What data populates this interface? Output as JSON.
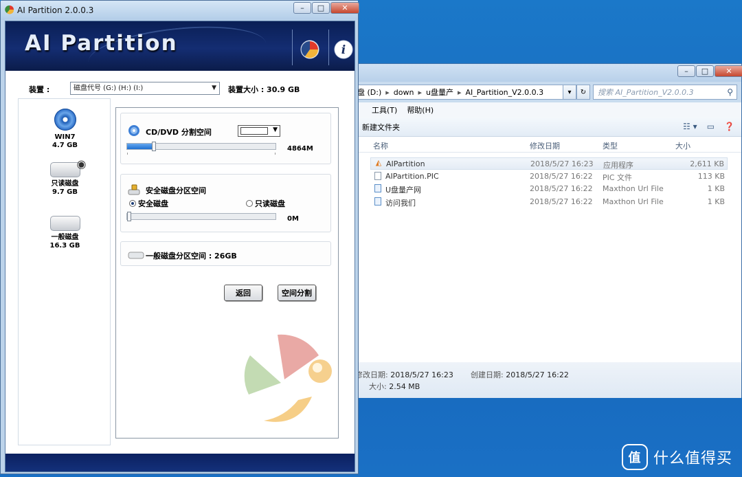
{
  "explorer": {
    "address_crumbs": [
      "盘 (D:)",
      "down",
      "u盘量产",
      "AI_Partition_V2.0.0.3"
    ],
    "search_placeholder": "搜索 AI_Partition_V2.0.0.3",
    "menu": [
      "工具(T)",
      "帮助(H)"
    ],
    "toolbar_new_folder": "新建文件夹",
    "columns": {
      "name": "名称",
      "modified": "修改日期",
      "type": "类型",
      "size": "大小"
    },
    "files": [
      {
        "name": "AIPartition",
        "modified": "2018/5/27 16:23",
        "type": "应用程序",
        "size": "2,611 KB",
        "icon": "app-icon"
      },
      {
        "name": "AIPartition.PIC",
        "modified": "2018/5/27 16:22",
        "type": "PIC 文件",
        "size": "113 KB",
        "icon": "file-icon"
      },
      {
        "name": "U盘量产网",
        "modified": "2018/5/27 16:22",
        "type": "Maxthon Url File",
        "size": "1 KB",
        "icon": "url-file-icon"
      },
      {
        "name": "访问我们",
        "modified": "2018/5/27 16:22",
        "type": "Maxthon Url File",
        "size": "1 KB",
        "icon": "url-file-icon"
      }
    ],
    "details": {
      "modified_label": "修改日期:",
      "modified_value": "2018/5/27 16:23",
      "created_label": "创建日期:",
      "created_value": "2018/5/27 16:22",
      "size_label": "大小:",
      "size_value": "2.54 MB"
    }
  },
  "aip": {
    "title": "AI Partition 2.0.0.3",
    "logo_text": "AI Partition",
    "device_label": "装置 :",
    "device_value": "磁盘代号 (G:) (H:) (I:)",
    "device_size": "装置大小 : 30.9 GB",
    "disks": [
      {
        "name": "WIN7",
        "size": "4.7 GB",
        "icon": "cd-disk-icon"
      },
      {
        "name": "只读磁盘",
        "size": "9.7 GB",
        "icon": "readonly-disk-icon"
      },
      {
        "name": "一般磁盘",
        "size": "16.3 GB",
        "icon": "normal-disk-icon"
      }
    ],
    "cd_group": {
      "title": "CD/DVD 分割空间",
      "value": "4864M",
      "fraction": 0.18
    },
    "secure_group": {
      "title": "安全磁盘分区空间",
      "option_secure": "安全磁盘",
      "option_readonly": "只读磁盘",
      "value": "0M",
      "fraction": 0.0
    },
    "normal_group": {
      "title": "一般磁盘分区空间 : 26GB"
    },
    "buttons": {
      "back": "返回",
      "split": "空间分割"
    }
  },
  "watermark": {
    "badge": "值",
    "text": "什么值得买"
  }
}
